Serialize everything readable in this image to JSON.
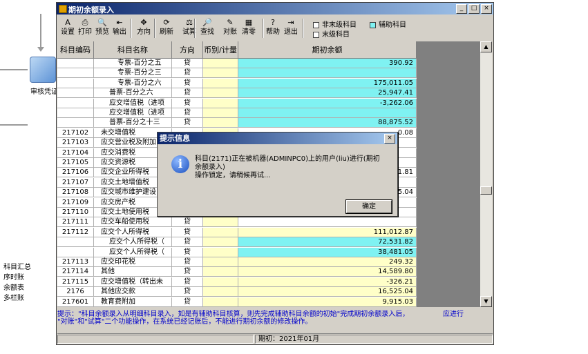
{
  "background": {
    "icon_label": "审核凭证",
    "menu": [
      "科目汇总",
      "序时账",
      "余额表",
      "多栏账"
    ]
  },
  "window": {
    "title": "期初余额录入",
    "controls": [
      "_",
      "□",
      "×"
    ]
  },
  "toolbar": [
    {
      "icon": "settings-icon",
      "glyph": "A",
      "label": "设置"
    },
    {
      "icon": "print-icon",
      "glyph": "⎙",
      "label": "打印"
    },
    {
      "icon": "preview-icon",
      "glyph": "🔍",
      "label": "预览"
    },
    {
      "icon": "export-icon",
      "glyph": "⇤",
      "label": "输出"
    },
    {
      "icon": "direction-icon",
      "glyph": "✥",
      "label": "方向"
    },
    {
      "icon": "refresh-icon",
      "glyph": "⟳",
      "label": "刷新"
    },
    {
      "icon": "trial-balance-icon",
      "glyph": "⚖",
      "label": "试算"
    },
    {
      "icon": "find-icon",
      "glyph": "🔎",
      "label": "查找"
    },
    {
      "icon": "reconcile-icon",
      "glyph": "✎",
      "label": "对账"
    },
    {
      "icon": "clear-icon",
      "glyph": "▦",
      "label": "清零"
    },
    {
      "icon": "help-icon",
      "glyph": "?",
      "label": "帮助"
    },
    {
      "icon": "exit-icon",
      "glyph": "⇥",
      "label": "退出"
    }
  ],
  "legend": {
    "non_leaf": "非末级科目",
    "auxiliary": "辅助科目",
    "leaf": "末级科目",
    "colors": {
      "non_leaf": "#ffffff",
      "auxiliary": "#7ff2f2",
      "leaf": "#ffffff"
    }
  },
  "grid": {
    "headers": [
      "科目编码",
      "科目名称",
      "方向",
      "币别/计量",
      "期初余额"
    ],
    "rows": [
      {
        "code": "",
        "name": "专票-百分之五",
        "dir": "贷",
        "amount": "390.92",
        "amt_color": "cyan",
        "indent": 2
      },
      {
        "code": "",
        "name": "专票-百分之三",
        "dir": "贷",
        "amount": "",
        "amt_color": "cyan",
        "indent": 2
      },
      {
        "code": "",
        "name": "专票-百分之六",
        "dir": "贷",
        "amount": "175,011.05",
        "amt_color": "cyan",
        "indent": 2
      },
      {
        "code": "",
        "name": "普票-百分之六",
        "dir": "贷",
        "amount": "25,947.41",
        "amt_color": "cyan",
        "indent": 1
      },
      {
        "code": "",
        "name": "应交增值税（进项",
        "dir": "贷",
        "amount": "-3,262.06",
        "amt_color": "cyan",
        "indent": 1
      },
      {
        "code": "",
        "name": "应交增值税（进项",
        "dir": "贷",
        "amount": "",
        "amt_color": "cyan",
        "indent": 1
      },
      {
        "code": "",
        "name": "普票-百分之十三",
        "dir": "贷",
        "amount": "88,875.52",
        "amt_color": "cyan",
        "indent": 1
      },
      {
        "code": "217102",
        "name": "未交增值税",
        "dir": "",
        "amount": "0.08",
        "amt_color": "white",
        "indent": 0
      },
      {
        "code": "217103",
        "name": "应交营业税及附加",
        "dir": "",
        "amount": "",
        "amt_color": "white",
        "indent": 0
      },
      {
        "code": "217104",
        "name": "应交消费税",
        "dir": "",
        "amount": "",
        "amt_color": "white",
        "indent": 0
      },
      {
        "code": "217105",
        "name": "应交资源税",
        "dir": "",
        "amount": "",
        "amt_color": "white",
        "indent": 0
      },
      {
        "code": "217106",
        "name": "应交企业所得税",
        "dir": "",
        "amount": "81.81",
        "amt_color": "white",
        "indent": 0
      },
      {
        "code": "217107",
        "name": "应交土地增值税",
        "dir": "",
        "amount": "",
        "amt_color": "white",
        "indent": 0
      },
      {
        "code": "217108",
        "name": "应交城市维护建设",
        "dir": "",
        "amount": "15.04",
        "amt_color": "white",
        "indent": 0
      },
      {
        "code": "217109",
        "name": "应交房产税",
        "dir": "",
        "amount": "",
        "amt_color": "white",
        "indent": 0
      },
      {
        "code": "217110",
        "name": "应交土地使用税",
        "dir": "",
        "amount": "",
        "amt_color": "white",
        "indent": 0
      },
      {
        "code": "217111",
        "name": "应交车船使用税",
        "dir": "贷",
        "amount": "",
        "amt_color": "white",
        "indent": 0
      },
      {
        "code": "217112",
        "name": "应交个人所得税",
        "dir": "贷",
        "amount": "111,012.87",
        "amt_color": "yellow",
        "indent": 0
      },
      {
        "code": "",
        "name": "应交个人所得税（",
        "dir": "贷",
        "amount": "72,531.82",
        "amt_color": "cyan",
        "indent": 1
      },
      {
        "code": "",
        "name": "应交个人所得税（",
        "dir": "贷",
        "amount": "38,481.05",
        "amt_color": "cyan",
        "indent": 1
      },
      {
        "code": "217113",
        "name": "应交印花税",
        "dir": "贷",
        "amount": "249.32",
        "amt_color": "yellow",
        "indent": 0
      },
      {
        "code": "217114",
        "name": "其他",
        "dir": "贷",
        "amount": "14,589.80",
        "amt_color": "yellow",
        "indent": 0
      },
      {
        "code": "217115",
        "name": "应交增值税（转出未",
        "dir": "贷",
        "amount": "-326.21",
        "amt_color": "yellow",
        "indent": 0
      },
      {
        "code": "2176",
        "name": "其他应交款",
        "dir": "贷",
        "amount": "16,525.04",
        "amt_color": "yellow",
        "indent": -1
      },
      {
        "code": "217601",
        "name": "教育费附加",
        "dir": "贷",
        "amount": "9,915.03",
        "amt_color": "yellow",
        "indent": 0
      }
    ]
  },
  "hint": {
    "line1": "提示：\"科目余额录入从明细科目录入，如是有辅助科目核算，则先完成辅助科目余额的初始\"完成期初余额录入后，",
    "line1_tail": "应进行",
    "line2": "\"对账\"和\"试算\"二个功能操作，在系统已经记账后，不能进行期初余额的修改操作。"
  },
  "status": {
    "period": "期初：2021年01月"
  },
  "dialog": {
    "title": "提示信息",
    "close": "×",
    "line1": "科目(2171)正在被机器(ADMINPC0)上的用户(liu)进行(期初",
    "line2": "余额录入)",
    "line3": "操作锁定，请稍候再试...",
    "ok_label": "确定"
  }
}
